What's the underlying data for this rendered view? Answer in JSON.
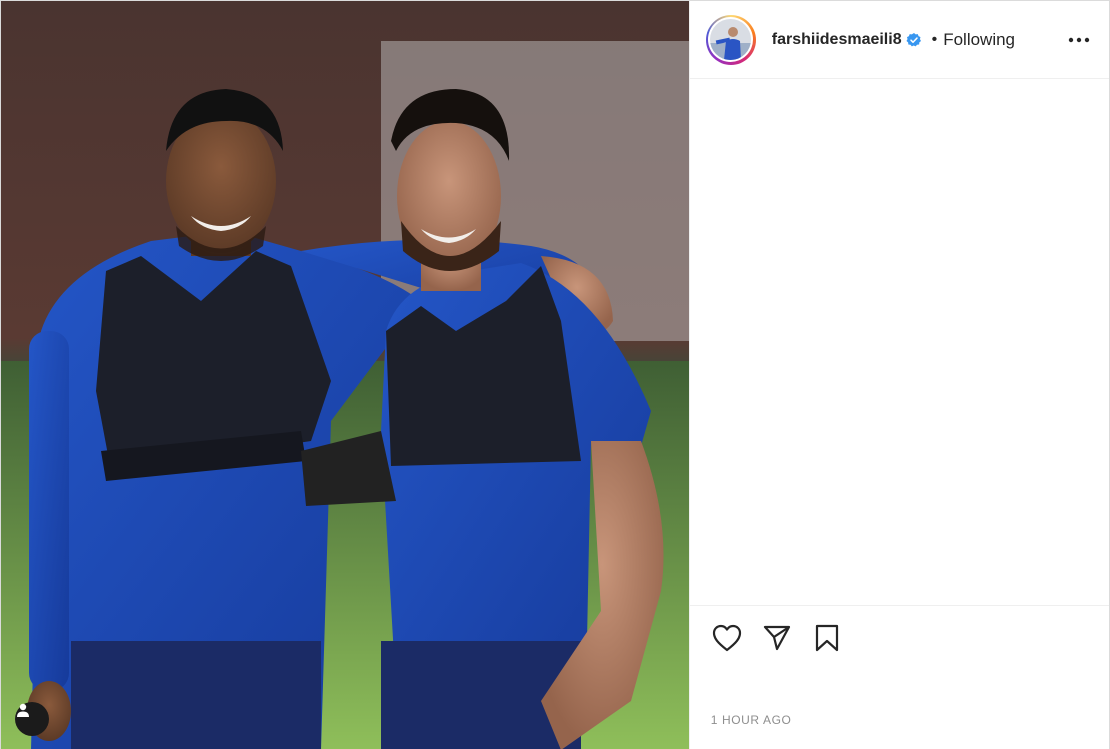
{
  "post": {
    "username": "farshiidesmaeili8",
    "verified": true,
    "follow_state": "Following",
    "separator": "•",
    "timestamp": "1 HOUR AGO"
  },
  "icons": {
    "verified": "verified-badge-icon",
    "more": "more-options-icon",
    "like": "heart-icon",
    "share": "paper-plane-icon",
    "save": "bookmark-icon",
    "tags": "user-tag-icon"
  },
  "colors": {
    "verified_blue": "#3897f0",
    "text_primary": "#262626",
    "text_secondary": "#8e8e8e",
    "divider": "#efefef"
  }
}
